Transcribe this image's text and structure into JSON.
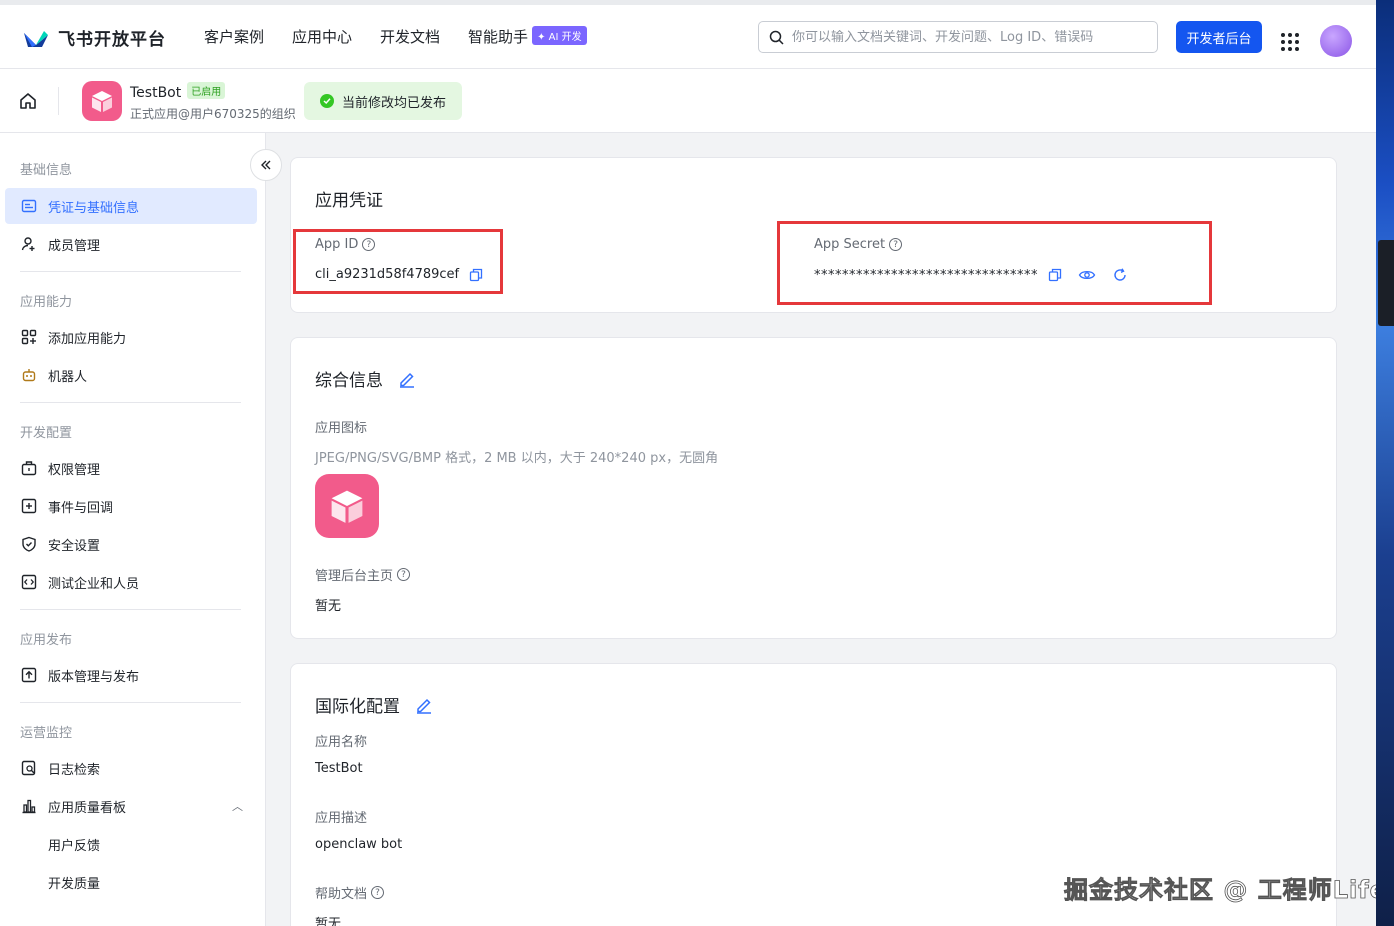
{
  "brand": {
    "name": "飞书开放平台"
  },
  "nav": {
    "links": [
      "客户案例",
      "应用中心",
      "开发文档",
      "智能助手"
    ],
    "ai_badge": "✦ AI 开发",
    "search_placeholder": "你可以输入文档关键词、开发问题、Log ID、错误码",
    "dev_console": "开发者后台"
  },
  "app": {
    "name": "TestBot",
    "status": "已启用",
    "org": "正式应用@用户670325的组织",
    "publish_status": "当前修改均已发布"
  },
  "sidebar": {
    "sections": [
      {
        "title": "基础信息",
        "items": [
          "凭证与基础信息",
          "成员管理"
        ]
      },
      {
        "title": "应用能力",
        "items": [
          "添加应用能力",
          "机器人"
        ]
      },
      {
        "title": "开发配置",
        "items": [
          "权限管理",
          "事件与回调",
          "安全设置",
          "测试企业和人员"
        ]
      },
      {
        "title": "应用发布",
        "items": [
          "版本管理与发布"
        ]
      },
      {
        "title": "运营监控",
        "items": [
          "日志检索",
          "应用质量看板",
          "用户反馈",
          "开发质量"
        ]
      }
    ]
  },
  "credentials": {
    "title": "应用凭证",
    "app_id_label": "App ID",
    "app_id": "cli_a9231d58f4789cef",
    "app_secret_label": "App Secret",
    "app_secret": "********************************"
  },
  "general": {
    "title": "综合信息",
    "icon_label": "应用图标",
    "icon_hint": "JPEG/PNG/SVG/BMP 格式，2 MB 以内，大于 240*240 px，无圆角",
    "admin_home_label": "管理后台主页",
    "admin_home_value": "暂无"
  },
  "i18n": {
    "title": "国际化配置",
    "name_label": "应用名称",
    "name_value": "TestBot",
    "desc_label": "应用描述",
    "desc_value": "openclaw bot",
    "help_label": "帮助文档",
    "help_value": "暂无"
  },
  "watermark": "掘金技术社区 @ 工程师Life",
  "colors": {
    "primary": "#1456f0",
    "accent_pink": "#f25b8b",
    "active_bg": "#e1eaff",
    "success": "#34c724",
    "highlight_red": "#e5383b"
  }
}
